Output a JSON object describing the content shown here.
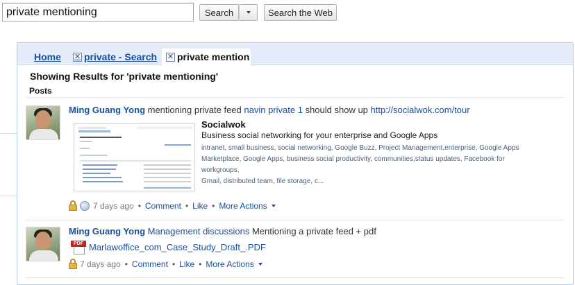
{
  "search": {
    "query": "private mentioning",
    "search_label": "Search",
    "web_label": "Search the Web"
  },
  "tabs": {
    "home": "Home",
    "search_tab": "private - Search",
    "active_tab": "private mention",
    "close_glyph": "✕"
  },
  "results": {
    "heading": "Showing Results for 'private mentioning'",
    "section": "Posts"
  },
  "posts": [
    {
      "author": "Ming Guang Yong",
      "text_before": " mentioning private feed ",
      "mention": "navin private 1",
      "text_after": " should show up ",
      "url": "http://socialwok.com/tour",
      "card": {
        "title": "Socialwok",
        "description": "Business social networking for your enterprise and Google Apps",
        "tags_line1": "intranet, small business, social networking, Google Buzz, Project Management,enterprise, Google Apps",
        "tags_line2": "Marketplace, Google Apps, business social productivity, communities,status updates, Facebook for workgroups,",
        "tags_line3": "Gmail, distributed team, file storage, c..."
      },
      "time": "7 days ago",
      "actions": {
        "comment": "Comment",
        "like": "Like",
        "more": "More Actions"
      }
    },
    {
      "author": "Ming Guang Yong",
      "feed": "Management discussions",
      "text": " Mentioning a private feed + pdf",
      "attachment": "Marlawoffice_com_Case_Study_Draft_.PDF",
      "pdf_badge": "PDF",
      "time": "7 days ago",
      "actions": {
        "comment": "Comment",
        "like": "Like",
        "more": "More Actions"
      }
    }
  ],
  "separator": "•",
  "colors": {
    "link": "#1b4f9a",
    "tabbar": "#e3ecf8",
    "panel_border": "#b9cde9"
  }
}
